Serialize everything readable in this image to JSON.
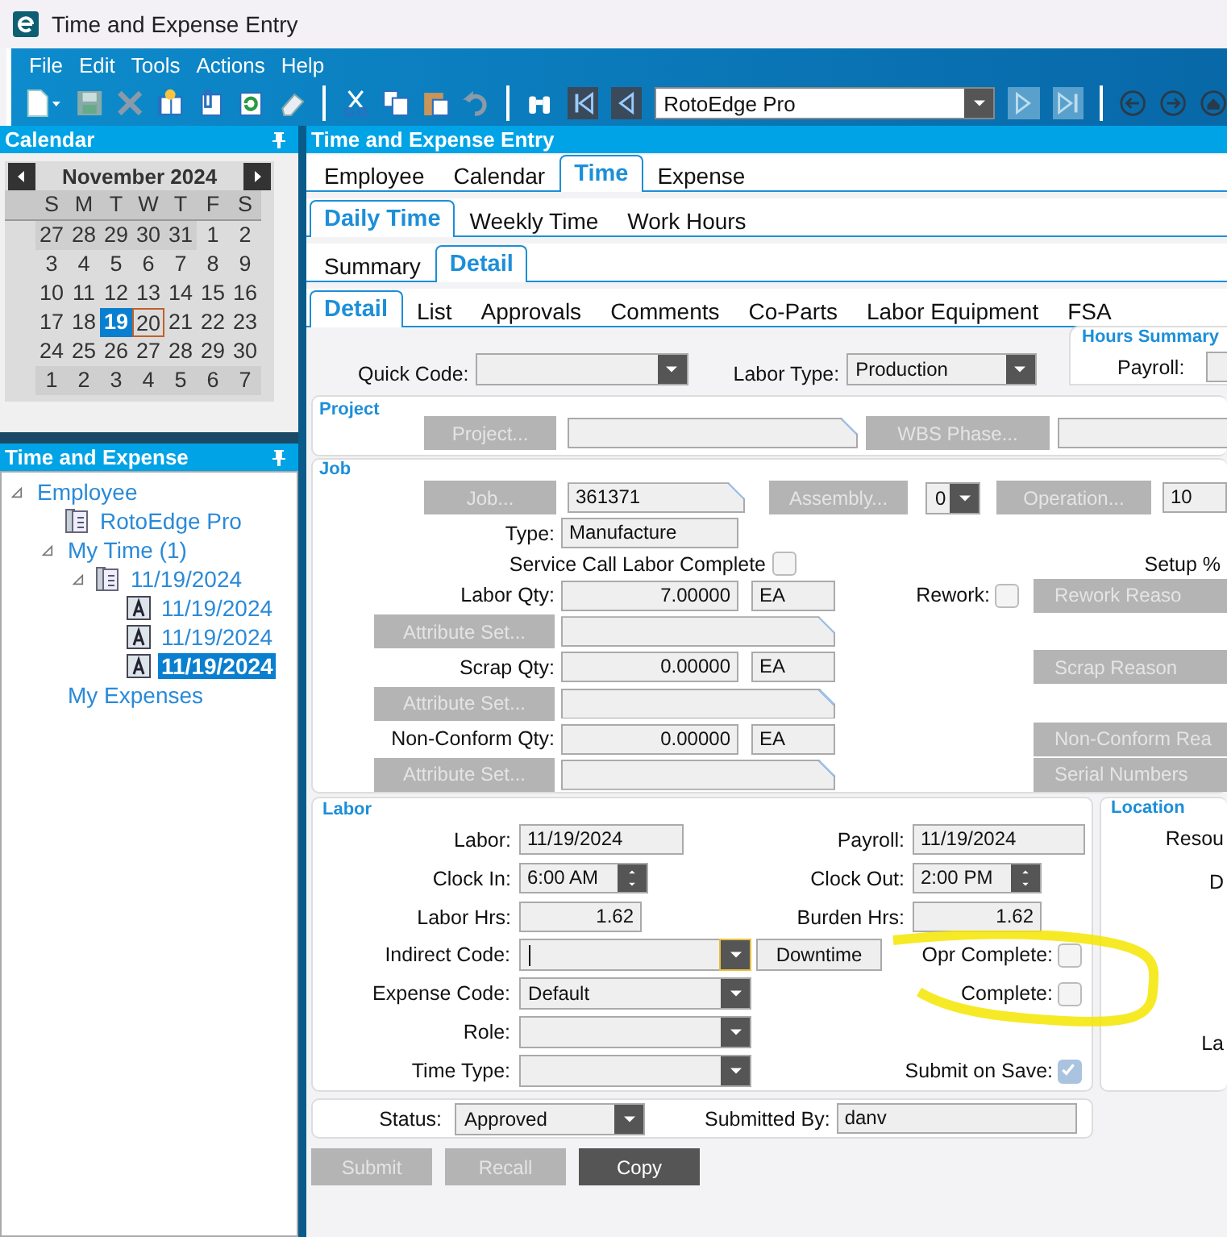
{
  "window": {
    "title": "Time and Expense Entry"
  },
  "menu": [
    "File",
    "Edit",
    "Tools",
    "Actions",
    "Help"
  ],
  "toolbar": {
    "record": "RotoEdge Pro"
  },
  "calendar": {
    "title": "Calendar",
    "month": "November 2024",
    "weekdays": [
      "S",
      "M",
      "T",
      "W",
      "T",
      "F",
      "S"
    ],
    "weeks": [
      [
        {
          "day": "27",
          "outside": true,
          "selected": false,
          "today": false
        },
        {
          "day": "28",
          "outside": true,
          "selected": false,
          "today": false
        },
        {
          "day": "29",
          "outside": true,
          "selected": false,
          "today": false
        },
        {
          "day": "30",
          "outside": true,
          "selected": false,
          "today": false
        },
        {
          "day": "31",
          "outside": true,
          "selected": false,
          "today": false
        },
        {
          "day": "1",
          "outside": false,
          "selected": false,
          "today": false
        },
        {
          "day": "2",
          "outside": false,
          "selected": false,
          "today": false
        }
      ],
      [
        {
          "day": "3",
          "outside": false,
          "selected": false,
          "today": false
        },
        {
          "day": "4",
          "outside": false,
          "selected": false,
          "today": false
        },
        {
          "day": "5",
          "outside": false,
          "selected": false,
          "today": false
        },
        {
          "day": "6",
          "outside": false,
          "selected": false,
          "today": false
        },
        {
          "day": "7",
          "outside": false,
          "selected": false,
          "today": false
        },
        {
          "day": "8",
          "outside": false,
          "selected": false,
          "today": false
        },
        {
          "day": "9",
          "outside": false,
          "selected": false,
          "today": false
        }
      ],
      [
        {
          "day": "10",
          "outside": false,
          "selected": false,
          "today": false
        },
        {
          "day": "11",
          "outside": false,
          "selected": false,
          "today": false
        },
        {
          "day": "12",
          "outside": false,
          "selected": false,
          "today": false
        },
        {
          "day": "13",
          "outside": false,
          "selected": false,
          "today": false
        },
        {
          "day": "14",
          "outside": false,
          "selected": false,
          "today": false
        },
        {
          "day": "15",
          "outside": false,
          "selected": false,
          "today": false
        },
        {
          "day": "16",
          "outside": false,
          "selected": false,
          "today": false
        }
      ],
      [
        {
          "day": "17",
          "outside": false,
          "selected": false,
          "today": false
        },
        {
          "day": "18",
          "outside": false,
          "selected": false,
          "today": false
        },
        {
          "day": "19",
          "outside": false,
          "selected": true,
          "today": false
        },
        {
          "day": "20",
          "outside": false,
          "selected": false,
          "today": true
        },
        {
          "day": "21",
          "outside": false,
          "selected": false,
          "today": false
        },
        {
          "day": "22",
          "outside": false,
          "selected": false,
          "today": false
        },
        {
          "day": "23",
          "outside": false,
          "selected": false,
          "today": false
        }
      ],
      [
        {
          "day": "24",
          "outside": false,
          "selected": false,
          "today": false
        },
        {
          "day": "25",
          "outside": false,
          "selected": false,
          "today": false
        },
        {
          "day": "26",
          "outside": false,
          "selected": false,
          "today": false
        },
        {
          "day": "27",
          "outside": false,
          "selected": false,
          "today": false
        },
        {
          "day": "28",
          "outside": false,
          "selected": false,
          "today": false
        },
        {
          "day": "29",
          "outside": false,
          "selected": false,
          "today": false
        },
        {
          "day": "30",
          "outside": false,
          "selected": false,
          "today": false
        }
      ],
      [
        {
          "day": "1",
          "outside": true,
          "selected": false,
          "today": false
        },
        {
          "day": "2",
          "outside": true,
          "selected": false,
          "today": false
        },
        {
          "day": "3",
          "outside": true,
          "selected": false,
          "today": false
        },
        {
          "day": "4",
          "outside": true,
          "selected": false,
          "today": false
        },
        {
          "day": "5",
          "outside": true,
          "selected": false,
          "today": false
        },
        {
          "day": "6",
          "outside": true,
          "selected": false,
          "today": false
        },
        {
          "day": "7",
          "outside": true,
          "selected": false,
          "today": false
        }
      ]
    ]
  },
  "tree": {
    "title": "Time and Expense",
    "items": [
      {
        "label": "Employee",
        "expanded": true,
        "selected": false,
        "children": [
          {
            "label": "RotoEdge Pro",
            "kind": "book",
            "selected": false
          },
          {
            "label": "My Time (1)",
            "expanded": true,
            "selected": false,
            "children": [
              {
                "label": "11/19/2024",
                "kind": "book",
                "expanded": true,
                "selected": false,
                "children": [
                  {
                    "label": "11/19/2024",
                    "kind": "doc",
                    "selected": false
                  },
                  {
                    "label": "11/19/2024",
                    "kind": "doc",
                    "selected": false
                  },
                  {
                    "label": "11/19/2024",
                    "kind": "doc",
                    "selected": true
                  }
                ]
              }
            ]
          },
          {
            "label": "My Expenses",
            "selected": false
          }
        ]
      }
    ]
  },
  "entry": {
    "title": "Time and Expense Entry",
    "tabs": [
      {
        "label": "Employee",
        "selected": false
      },
      {
        "label": "Calendar",
        "selected": false
      },
      {
        "label": "Time",
        "selected": true
      },
      {
        "label": "Expense",
        "selected": false
      }
    ],
    "time_tabs": [
      {
        "label": "Daily Time",
        "selected": true
      },
      {
        "label": "Weekly Time",
        "selected": false
      },
      {
        "label": "Work Hours",
        "selected": false
      }
    ],
    "view_tabs": [
      {
        "label": "Summary",
        "selected": false
      },
      {
        "label": "Detail",
        "selected": true
      }
    ],
    "detail_tabs": [
      {
        "label": "Detail",
        "selected": true
      },
      {
        "label": "List",
        "selected": false
      },
      {
        "label": "Approvals",
        "selected": false
      },
      {
        "label": "Comments",
        "selected": false
      },
      {
        "label": "Co-Parts",
        "selected": false
      },
      {
        "label": "Labor Equipment",
        "selected": false
      },
      {
        "label": "FSA",
        "selected": false
      }
    ]
  },
  "quick_code": {
    "label": "Quick Code:"
  },
  "labor_type": {
    "label": "Labor Type:",
    "value": "Production"
  },
  "hours_summary": {
    "title": "Hours Summary",
    "payroll_label": "Payroll:"
  },
  "project": {
    "title": "Project",
    "project_button": {
      "label": "Project...",
      "disabled": true
    },
    "project_field": {
      "lookup": true
    },
    "wbs_button": {
      "label": "WBS Phase...",
      "disabled": true
    }
  },
  "job": {
    "title": "Job",
    "job_button": {
      "label": "Job...",
      "disabled": true
    },
    "job": {
      "value": "361371",
      "lookup": true
    },
    "assembly_button": {
      "label": "Assembly...",
      "disabled": true
    },
    "assembly": {
      "value": "0"
    },
    "operation_button": {
      "label": "Operation...",
      "disabled": true
    },
    "operation": {
      "value": "10"
    },
    "type": {
      "label": "Type:",
      "value": "Manufacture"
    },
    "service_call": {
      "label": "Service Call Labor Complete",
      "checked": false
    },
    "setup_label": "Setup %",
    "rework": {
      "label": "Rework:",
      "checked": false
    },
    "quantities": [
      {
        "label": "Labor Qty:",
        "value": "7.00000",
        "unit": "EA",
        "reason_button": {
          "label": "Rework Reaso",
          "disabled": true
        },
        "attribute_button": {
          "label": "Attribute Set...",
          "disabled": true
        },
        "attribute_field": {
          "lookup": true
        }
      },
      {
        "label": "Scrap Qty:",
        "value": "0.00000",
        "unit": "EA",
        "reason_button": {
          "label": "Scrap Reason",
          "disabled": true
        },
        "attribute_button": {
          "label": "Attribute Set...",
          "disabled": true
        },
        "attribute_field": {
          "lookup": true
        }
      },
      {
        "label": "Non-Conform Qty:",
        "value": "0.00000",
        "unit": "EA",
        "reason_button": {
          "label": "Non-Conform Rea",
          "disabled": true
        },
        "attribute_button": {
          "label": "Attribute Set...",
          "disabled": true
        },
        "attribute_field": {
          "lookup": true
        }
      }
    ],
    "serial_button": {
      "label": "Serial Numbers",
      "disabled": true
    }
  },
  "labor": {
    "title": "Labor",
    "rows": [
      {
        "kind": "field",
        "label": "Labor:",
        "value": "11/19/2024",
        "right": {
          "kind": "field",
          "label": "Payroll:",
          "value": "11/19/2024"
        }
      },
      {
        "kind": "spinner",
        "label": "Clock In:",
        "value": "6:00 AM",
        "right": {
          "kind": "spinner",
          "label": "Clock Out:",
          "value": "2:00 PM"
        }
      },
      {
        "kind": "number",
        "label": "Labor Hrs:",
        "value": "1.62",
        "right": {
          "kind": "number",
          "label": "Burden Hrs:",
          "value": "1.62"
        }
      },
      {
        "kind": "combo",
        "label": "Indirect Code:",
        "focused": true,
        "button": {
          "label": "Downtime",
          "disabled": false
        },
        "right": {
          "kind": "check",
          "label": "Opr Complete:",
          "checked": false,
          "disabled": false
        }
      },
      {
        "kind": "combo",
        "label": "Expense Code:",
        "value": "Default",
        "focused": false,
        "right": {
          "kind": "check",
          "label": "Complete:",
          "checked": false,
          "disabled": false
        }
      },
      {
        "kind": "combo",
        "label": "Role:",
        "focused": false
      },
      {
        "kind": "combo",
        "label": "Time Type:",
        "focused": false,
        "right": {
          "kind": "check",
          "label": "Submit on Save:",
          "checked": true,
          "disabled": true
        }
      }
    ]
  },
  "location": {
    "title": "Location",
    "labels": [
      "Resou",
      "D",
      "La"
    ]
  },
  "status": {
    "label": "Status:",
    "value": "Approved",
    "submitted_label": "Submitted By:",
    "submitted_by": "danv"
  },
  "actions": [
    {
      "label": "Submit",
      "disabled": true
    },
    {
      "label": "Recall",
      "disabled": true
    },
    {
      "label": "Copy",
      "disabled": false
    }
  ]
}
